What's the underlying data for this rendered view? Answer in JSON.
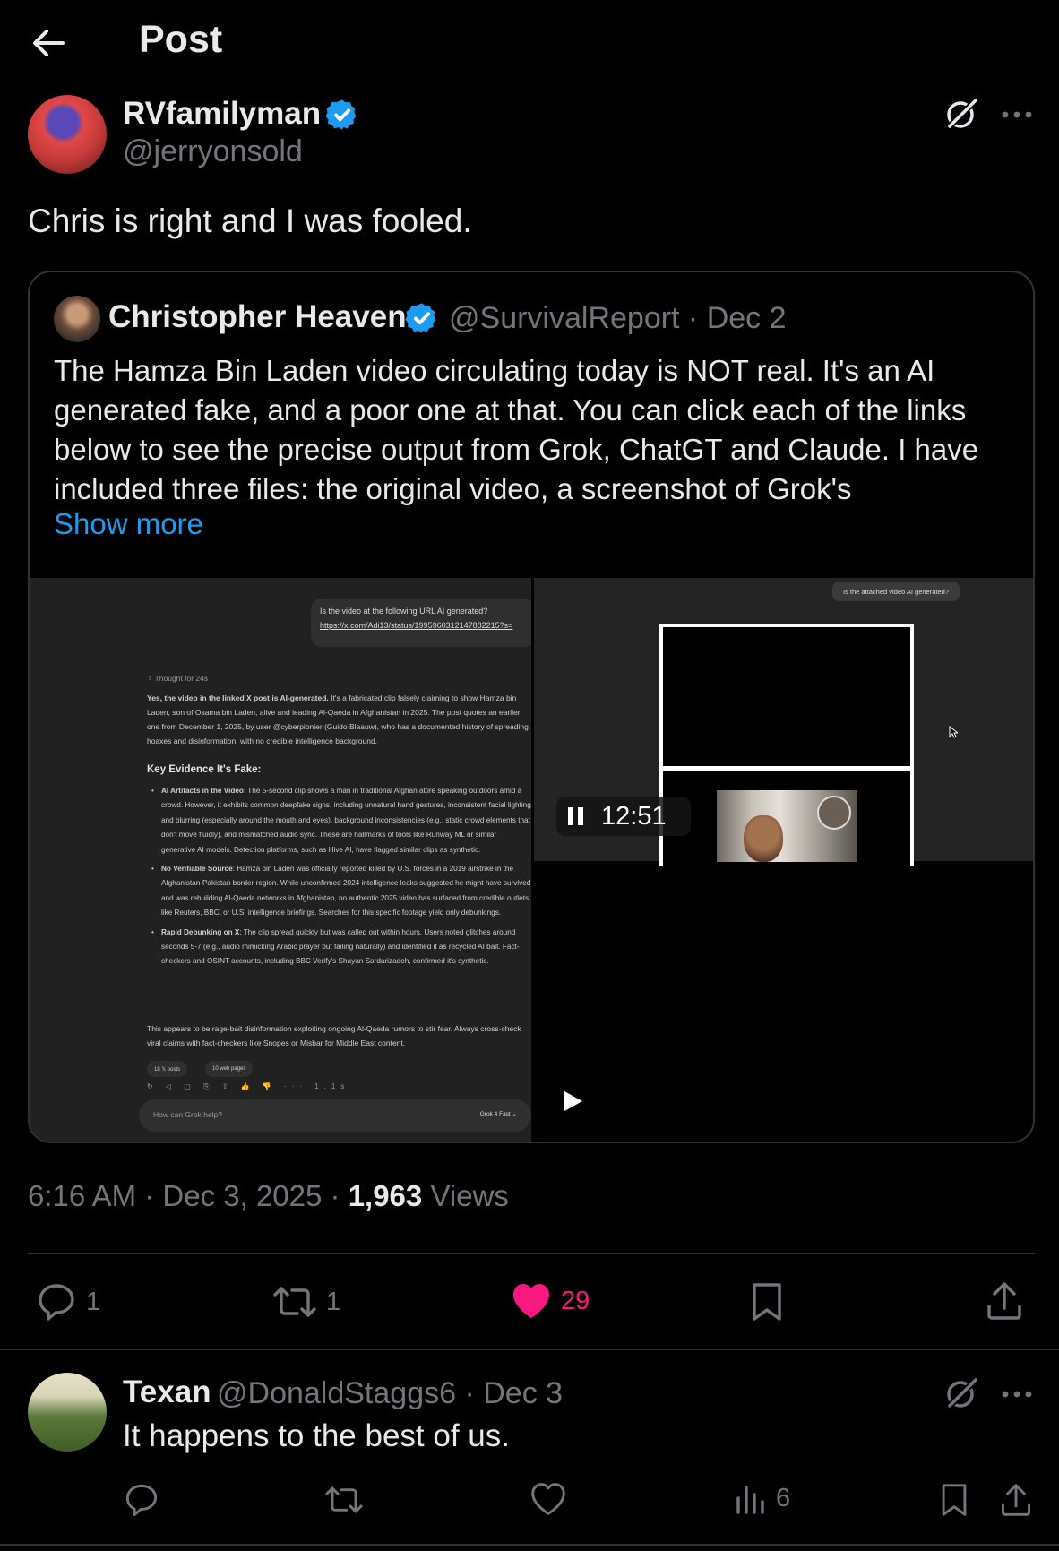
{
  "header": {
    "title": "Post",
    "back_icon": "back-arrow-icon"
  },
  "post": {
    "author_name": "RVfamilyman",
    "author_handle": "@jerryonsold",
    "text": "Chris is right and I was fooled.",
    "quote": {
      "author_name": "Christopher Heaven",
      "author_handle_date": "@SurvivalReport · Dec 2",
      "text": "The Hamza Bin Laden video circulating today is NOT real. It's an AI generated fake, and a poor one at that. You can click each of the links below to see the precise output from Grok, ChatGT and Claude. I have included three files: the original video, a screenshot of Grok's",
      "show_more": "Show more",
      "screenshot": {
        "question": "Is the video at the following URL AI generated?",
        "url": "https://x.com/Adi13/status/1995960312147882215?s=",
        "thought": "♀ Thought for 24s",
        "body_bold": "Yes, the video in the linked X post is AI-generated.",
        "body": " It's a fabricated clip falsely claiming to show Hamza bin Laden, son of Osama bin Laden, alive and leading Al-Qaeda in Afghanistan in 2025. The post quotes an earlier one from December 1, 2025, by user @cyberpionier (Guido Blaauw), who has a documented history of spreading hoaxes and disinformation, with no credible intelligence background.",
        "heading": "Key Evidence It's Fake:",
        "items": [
          {
            "title": "AI Artifacts in the Video",
            "text": ": The 5-second clip shows a man in traditional Afghan attire speaking outdoors amid a crowd. However, it exhibits common deepfake signs, including unnatural hand gestures, inconsistent facial lighting and blurring (especially around the mouth and eyes), background inconsistencies (e.g., static crowd elements that don't move fluidly), and mismatched audio sync. These are hallmarks of tools like Runway ML or similar generative AI models. Detection platforms, such as Hive AI, have flagged similar clips as synthetic."
          },
          {
            "title": "No Verifiable Source",
            "text": ": Hamza bin Laden was officially reported killed by U.S. forces in a 2019 airstrike in the Afghanistan-Pakistan border region. While unconfirmed 2024 intelligence leaks suggested he might have survived and was rebuilding Al-Qaeda networks in Afghanistan, no authentic 2025 video has surfaced from credible outlets like Reuters, BBC, or U.S. intelligence briefings. Searches for this specific footage yield only debunkings."
          },
          {
            "title": "Rapid Debunking on X",
            "text": ": The clip spread quickly but was called out within hours. Users noted glitches around seconds 5-7 (e.g., audio mimicking Arabic prayer but failing naturally) and identified it as recycled AI bait. Fact-checkers and OSINT accounts, including BBC Verify's Shayan Sardarizadeh, confirmed it's synthetic."
          }
        ],
        "footer": "This appears to be rage-bait disinformation exploiting ongoing Al-Qaeda rumors to stir fear. Always cross-check viral claims with fact-checkers like Snopes or Misbar for Middle East content.",
        "chip1": "18 𝕏 posts",
        "chip2": "10 web pages",
        "toolbar_icons": "↻ ◁ ▢ ⎘ ⇪ 👍 👎 ··· 1.1s",
        "input_placeholder": "How can Grok help?",
        "model": "Grok 4 Fast ⌄"
      },
      "video": {
        "bubble": "Is the attached video AI generated?",
        "time": "12:51"
      }
    },
    "meta": {
      "time_date": "6:16 AM · Dec 3, 2025 · ",
      "views_count": "1,963",
      "views_label": " Views"
    },
    "actions": {
      "replies": "1",
      "reposts": "1",
      "likes": "29"
    }
  },
  "reply": {
    "author_name": "Texan",
    "author_handle_date": "@DonaldStaggs6 · Dec 3",
    "text": "It happens to the best of us.",
    "views": "6"
  },
  "colors": {
    "accent": "#1d9bf0",
    "like": "#f91880",
    "muted": "#71767b",
    "text": "#e7e9ea"
  }
}
